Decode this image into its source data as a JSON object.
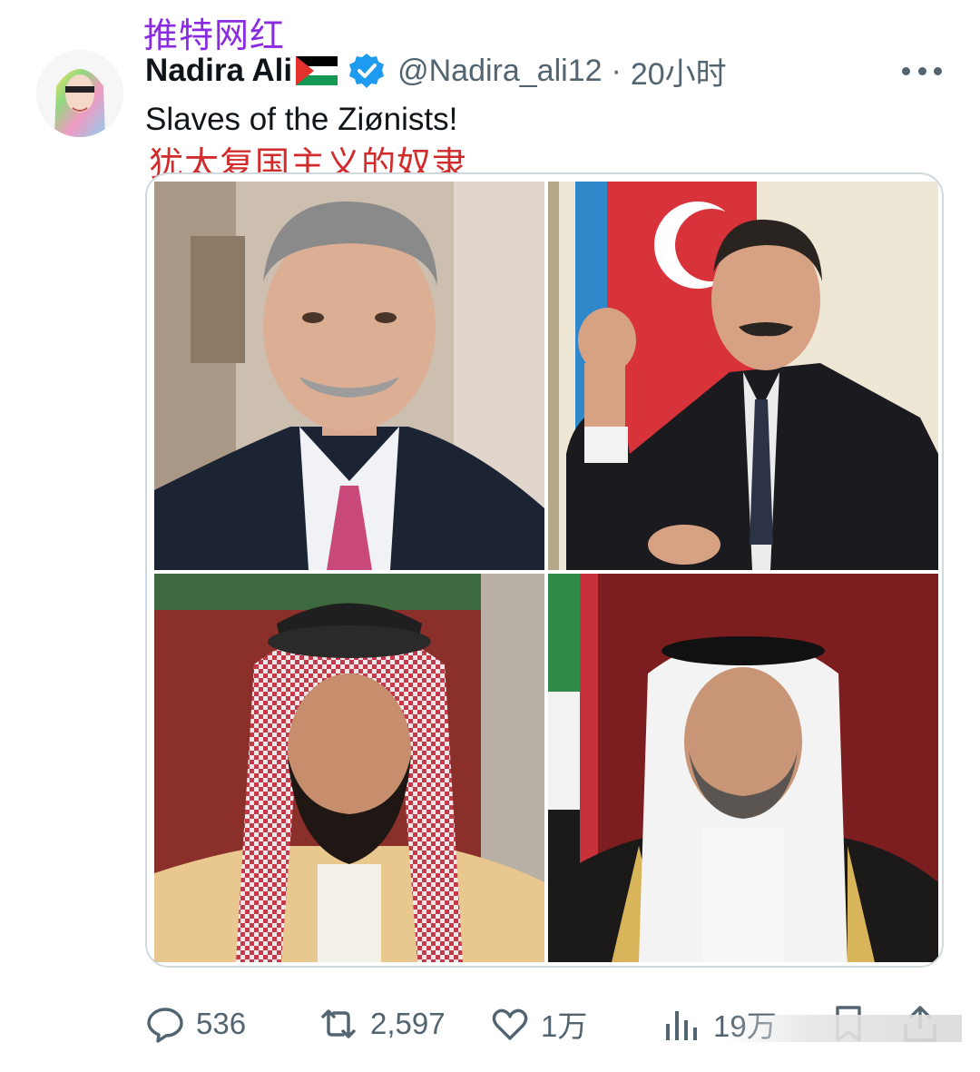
{
  "overlay_label": "推特网红",
  "tweet": {
    "display_name": "Nadira Ali",
    "handle": "@Nadira_ali12",
    "separator": "·",
    "time": "20小时",
    "text": "Slaves of the Ziønists!",
    "translation": "犹太复国主义的奴隶"
  },
  "icons": {
    "flag": "palestine-flag-icon",
    "verified": "verified-badge-icon",
    "more": "more-options-icon",
    "reply": "reply-icon",
    "retweet": "retweet-icon",
    "like": "heart-icon",
    "views": "views-chart-icon",
    "bookmark": "bookmark-icon",
    "share": "share-icon"
  },
  "actions": {
    "replies": "536",
    "retweets": "2,597",
    "likes": "1万",
    "views": "19万"
  },
  "colors": {
    "verified": "#1d9bf0",
    "secondary_text": "#536471",
    "overlay_label": "#8a2be2",
    "translation": "#d22b2b"
  }
}
